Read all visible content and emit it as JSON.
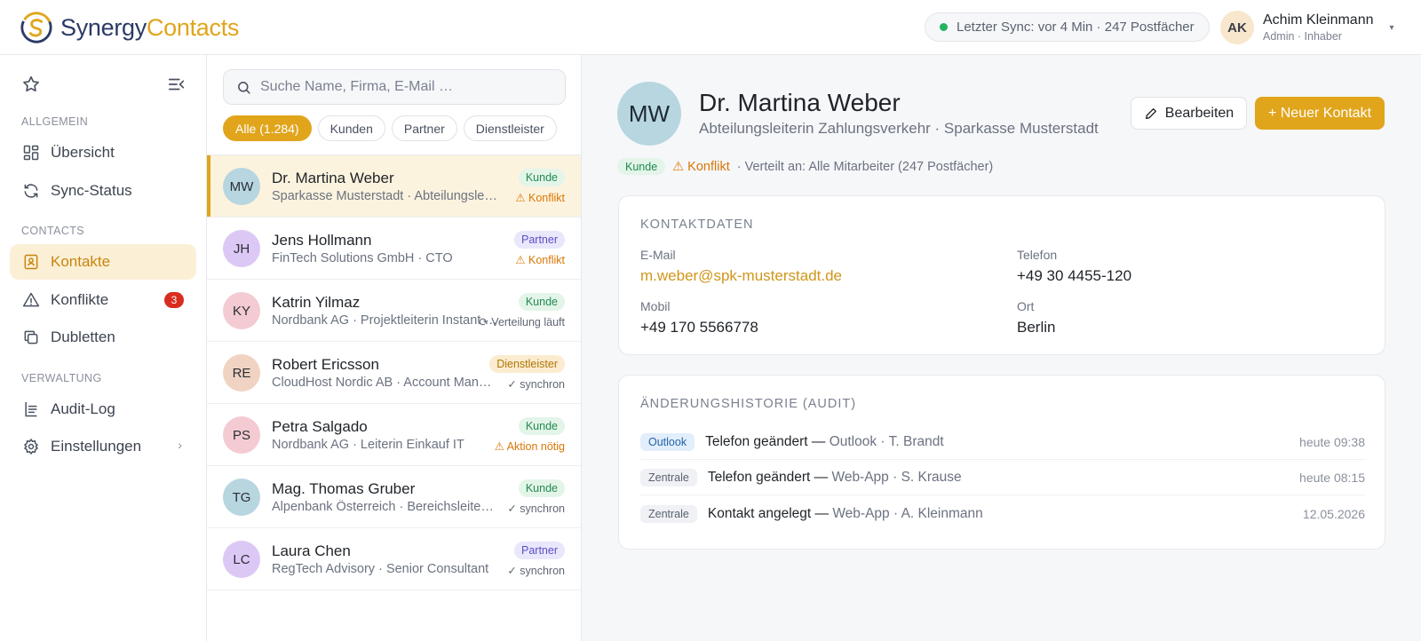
{
  "brand": {
    "part1": "Synergy",
    "part2": "Contacts"
  },
  "sync": {
    "text": "Letzter Sync: vor 4 Min · 247 Postfächer"
  },
  "user": {
    "initials": "AK",
    "name": "Achim Kleinmann",
    "role": "Admin · Inhaber"
  },
  "sidebar": {
    "section_general": "ALLGEMEIN",
    "section_contacts": "CONTACTS",
    "section_admin": "VERWALTUNG",
    "items": {
      "overview": "Übersicht",
      "sync_status": "Sync-Status",
      "contacts": "Kontakte",
      "conflicts": "Konflikte",
      "conflicts_count": "3",
      "duplicates": "Dubletten",
      "audit_log": "Audit-Log",
      "settings": "Einstellungen"
    }
  },
  "search": {
    "placeholder": "Suche Name, Firma, E-Mail …"
  },
  "filters": [
    "Alle (1.284)",
    "Kunden",
    "Partner",
    "Dienstleister"
  ],
  "contacts": [
    {
      "initials": "MW",
      "name": "Dr. Martina Weber",
      "sub": "Sparkasse Musterstadt · Abteilungsleiterin Zahlungsverkehr",
      "tag": "Kunde",
      "status": "⚠ Konflikt"
    },
    {
      "initials": "JH",
      "name": "Jens Hollmann",
      "sub": "FinTech Solutions GmbH · CTO",
      "tag": "Partner",
      "status": "⚠ Konflikt"
    },
    {
      "initials": "KY",
      "name": "Katrin Yilmaz",
      "sub": "Nordbank AG · Projektleiterin Instant Payments",
      "tag": "Kunde",
      "status": "⟳ Verteilung läuft"
    },
    {
      "initials": "RE",
      "name": "Robert Ericsson",
      "sub": "CloudHost Nordic AB · Account Manager",
      "tag": "Dienstleister",
      "status": "✓ synchron"
    },
    {
      "initials": "PS",
      "name": "Petra Salgado",
      "sub": "Nordbank AG · Leiterin Einkauf IT",
      "tag": "Kunde",
      "status": "⚠ Aktion nötig"
    },
    {
      "initials": "TG",
      "name": "Mag. Thomas Gruber",
      "sub": "Alpenbank Österreich · Bereichsleiter Digital",
      "tag": "Kunde",
      "status": "✓ synchron"
    },
    {
      "initials": "LC",
      "name": "Laura Chen",
      "sub": "RegTech Advisory · Senior Consultant",
      "tag": "Partner",
      "status": "✓ synchron"
    }
  ],
  "detail": {
    "initials": "MW",
    "name": "Dr. Martina Weber",
    "subtitle": "Abteilungsleiterin Zahlungsverkehr · Sparkasse Musterstadt",
    "edit_label": "Bearbeiten",
    "new_label": "+ Neuer Kontakt",
    "tag": "Kunde",
    "conflict": "⚠ Konflikt",
    "distributed": "· Verteilt an: Alle Mitarbeiter (247 Postfächer)",
    "contact_title": "KONTAKTDATEN",
    "email_label": "E-Mail",
    "email": "m.weber@spk-musterstadt.de",
    "phone_label": "Telefon",
    "phone": "+49 30 4455-120",
    "mobile_label": "Mobil",
    "mobile": "+49 170 5566778",
    "city_label": "Ort",
    "city": "Berlin",
    "audit_title": "ÄNDERUNGSHISTORIE (AUDIT)",
    "audit": [
      {
        "source": "Outlook",
        "action": "Telefon geändert —",
        "by": "Outlook · T. Brandt",
        "time": "heute 09:38"
      },
      {
        "source": "Zentrale",
        "action": "Telefon geändert —",
        "by": "Web-App · S. Krause",
        "time": "heute 08:15"
      },
      {
        "source": "Zentrale",
        "action": "Kontakt angelegt —",
        "by": "Web-App · A. Kleinmann",
        "time": "12.05.2026"
      }
    ]
  },
  "colors": {
    "accent": "#e1a51c",
    "brand_dark": "#2b3a67",
    "warn": "#d97706",
    "success": "#22b35e"
  }
}
